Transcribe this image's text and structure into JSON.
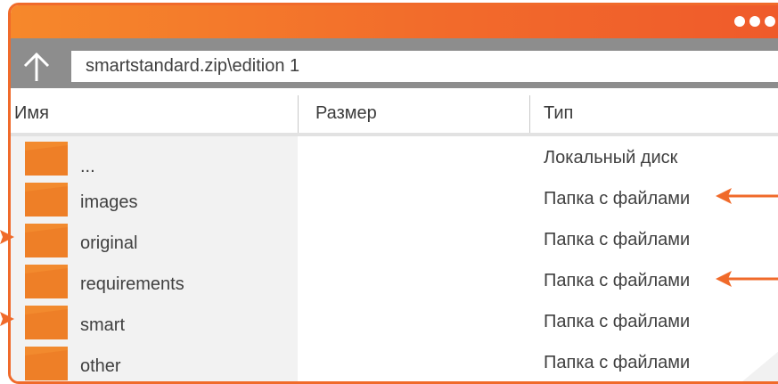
{
  "window": {
    "accent_color": "#f06a2a",
    "path": "smartstandard.zip\\edition 1"
  },
  "columns": {
    "name": "Имя",
    "size": "Размер",
    "type": "Тип"
  },
  "rows": [
    {
      "name": "...",
      "size": "",
      "type": "Локальный диск",
      "icon": "folder-icon"
    },
    {
      "name": "images",
      "size": "",
      "type": "Папка с файлами",
      "icon": "folder-icon"
    },
    {
      "name": "original",
      "size": "",
      "type": "Папка с файлами",
      "icon": "folder-icon"
    },
    {
      "name": "requirements",
      "size": "",
      "type": "Папка с файлами",
      "icon": "folder-icon"
    },
    {
      "name": "smart",
      "size": "",
      "type": "Папка с файлами",
      "icon": "folder-icon"
    },
    {
      "name": "other",
      "size": "",
      "type": "Папка с файлами",
      "icon": "folder-icon"
    }
  ],
  "icons": {
    "up": "arrow-up-icon",
    "menu": "more-dots-icon",
    "folder": "folder-icon",
    "pointer": "arrow-pointer-icon"
  }
}
